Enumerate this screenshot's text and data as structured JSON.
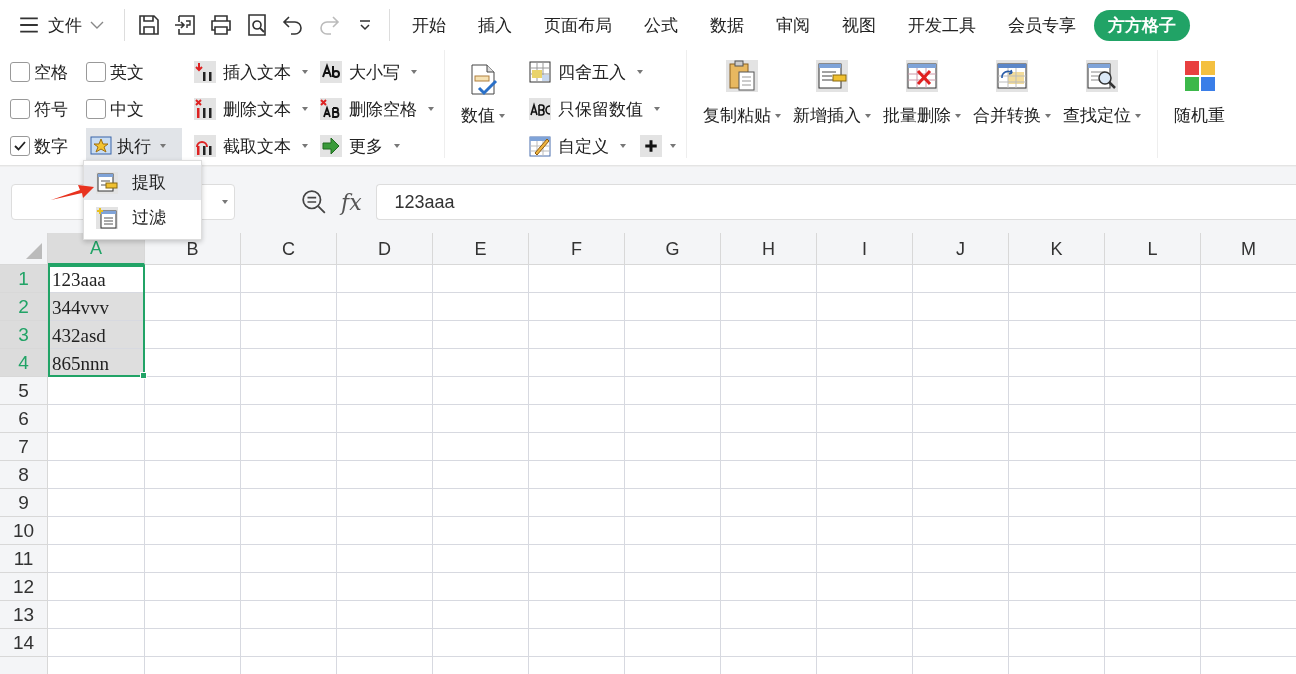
{
  "menu_bar": {
    "file_label": "文件",
    "tabs": [
      {
        "label": "开始",
        "selected": false
      },
      {
        "label": "插入",
        "selected": false
      },
      {
        "label": "页面布局",
        "selected": false
      },
      {
        "label": "公式",
        "selected": false
      },
      {
        "label": "数据",
        "selected": false
      },
      {
        "label": "审阅",
        "selected": false
      },
      {
        "label": "视图",
        "selected": false
      },
      {
        "label": "开发工具",
        "selected": false
      },
      {
        "label": "会员专享",
        "selected": false
      },
      {
        "label": "方方格子",
        "selected": true
      }
    ]
  },
  "ribbon": {
    "options": [
      {
        "label": "空格",
        "checked": false
      },
      {
        "label": "英文",
        "checked": false
      },
      {
        "label": "符号",
        "checked": false
      },
      {
        "label": "中文",
        "checked": false
      },
      {
        "label": "数字",
        "checked": true
      }
    ],
    "execute": {
      "label": "执行",
      "expanded": true,
      "menu": [
        {
          "label": "提取",
          "kind": "extract",
          "selected": true
        },
        {
          "label": "过滤",
          "kind": "filter",
          "selected": false
        }
      ]
    },
    "text_tools": [
      {
        "label": "插入文本",
        "kind": "insert"
      },
      {
        "label": "删除文本",
        "kind": "delete"
      },
      {
        "label": "截取文本",
        "kind": "cut"
      }
    ],
    "case_tools": [
      {
        "label": "大小写",
        "kind": "case"
      },
      {
        "label": "删除空格",
        "kind": "despace"
      },
      {
        "label": "更多",
        "kind": "more"
      }
    ],
    "number": {
      "label": "数值"
    },
    "number_tools": [
      {
        "label": "四舍五入",
        "kind": "round"
      },
      {
        "label": "只保留数值",
        "kind": "abc"
      },
      {
        "label": "自定义",
        "kind": "custom"
      }
    ],
    "big_buttons": [
      {
        "label": "复制粘贴",
        "kind": "paste",
        "caret": true
      },
      {
        "label": "新增插入",
        "kind": "insert",
        "caret": true
      },
      {
        "label": "批量删除",
        "kind": "delete",
        "caret": true
      },
      {
        "label": "合并转换",
        "kind": "merge",
        "caret": true
      },
      {
        "label": "查找定位",
        "kind": "find",
        "caret": true
      }
    ],
    "more_buttons": [
      {
        "label": "随机重",
        "kind": "random",
        "caret": false
      }
    ]
  },
  "formula_bar": {
    "fx": "fx",
    "formula": "123aaa"
  },
  "sheet": {
    "columns": [
      {
        "label": "A",
        "selected": true
      },
      {
        "label": "B",
        "selected": false
      },
      {
        "label": "C",
        "selected": false
      },
      {
        "label": "D",
        "selected": false
      },
      {
        "label": "E",
        "selected": false
      },
      {
        "label": "F",
        "selected": false
      },
      {
        "label": "G",
        "selected": false
      },
      {
        "label": "H",
        "selected": false
      },
      {
        "label": "I",
        "selected": false
      },
      {
        "label": "J",
        "selected": false
      },
      {
        "label": "K",
        "selected": false
      },
      {
        "label": "L",
        "selected": false
      },
      {
        "label": "M",
        "selected": false
      }
    ],
    "rows": [
      {
        "label": "1",
        "selected": true,
        "cells": [
          {
            "text": "123aaa",
            "active": true
          }
        ]
      },
      {
        "label": "2",
        "selected": true,
        "cells": [
          {
            "text": "344vvv",
            "active": false
          }
        ]
      },
      {
        "label": "3",
        "selected": true,
        "cells": [
          {
            "text": "432asd",
            "active": false
          }
        ]
      },
      {
        "label": "4",
        "selected": true,
        "cells": [
          {
            "text": "865nnn",
            "active": false
          }
        ]
      },
      {
        "label": "5",
        "selected": false,
        "cells": []
      },
      {
        "label": "6",
        "selected": false,
        "cells": []
      },
      {
        "label": "7",
        "selected": false,
        "cells": []
      },
      {
        "label": "8",
        "selected": false,
        "cells": []
      },
      {
        "label": "9",
        "selected": false,
        "cells": []
      },
      {
        "label": "10",
        "selected": false,
        "cells": []
      },
      {
        "label": "11",
        "selected": false,
        "cells": []
      },
      {
        "label": "12",
        "selected": false,
        "cells": []
      },
      {
        "label": "13",
        "selected": false,
        "cells": []
      },
      {
        "label": "14",
        "selected": false,
        "cells": []
      }
    ]
  }
}
